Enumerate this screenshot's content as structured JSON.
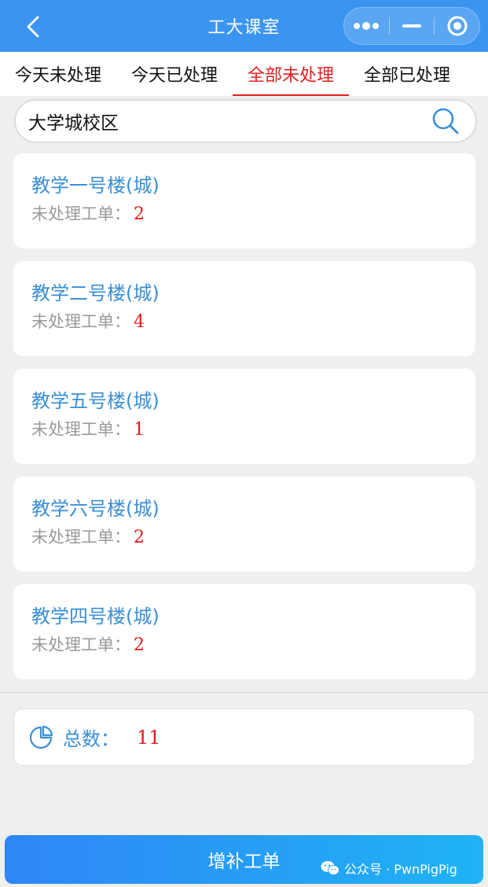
{
  "nav": {
    "title": "工大课室"
  },
  "tabs": [
    {
      "label": "今天未处理",
      "active": false
    },
    {
      "label": "今天已处理",
      "active": false
    },
    {
      "label": "全部未处理",
      "active": true
    },
    {
      "label": "全部已处理",
      "active": false
    }
  ],
  "search": {
    "value": "大学城校区"
  },
  "buildings": [
    {
      "name": "教学一号楼(城)",
      "label": "未处理工单：",
      "count": "2"
    },
    {
      "name": "教学二号楼(城)",
      "label": "未处理工单：",
      "count": "4"
    },
    {
      "name": "教学五号楼(城)",
      "label": "未处理工单：",
      "count": "1"
    },
    {
      "name": "教学六号楼(城)",
      "label": "未处理工单：",
      "count": "2"
    },
    {
      "name": "教学四号楼(城)",
      "label": "未处理工单：",
      "count": "2"
    }
  ],
  "summary": {
    "label": "总数：",
    "total": "11"
  },
  "footer": {
    "button_label": "增补工单",
    "watermark": "公众号 · PwnPigPig"
  },
  "colors": {
    "primary": "#3b95f0",
    "link": "#3b8fd6",
    "alert": "#e01a1a"
  },
  "icons": {
    "back": "chevron-left-icon",
    "more": "more-dots-icon",
    "minimize": "minimize-icon",
    "close": "target-circle-icon",
    "search": "search-icon",
    "total": "pie-chart-icon",
    "watermark": "wechat-icon"
  }
}
